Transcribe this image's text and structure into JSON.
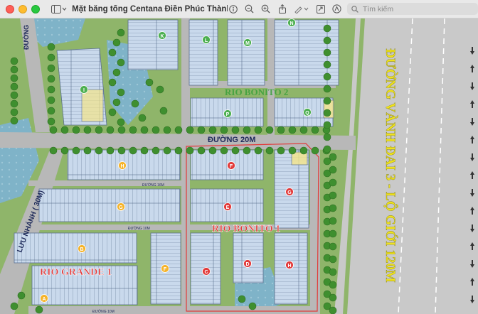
{
  "window": {
    "title": "Mặt bằng tổng Centana Điền Phúc Thành.jpg",
    "search_placeholder": "Tìm kiếm"
  },
  "map": {
    "roads": {
      "main_road": "ĐƯỜNG 20M",
      "left_top_road": "ĐƯỜNG",
      "left_diagonal_road": "LƯU NHÁNH ( 30M)",
      "inner_road_1": "ĐƯỜNG 16M",
      "inner_road_2": "ĐƯỜNG 10M",
      "inner_road_3": "ĐƯỜNG 10M",
      "ring_road": "ĐƯỜNG VÀNH ĐAI 3 - LỘ GIỚI 120M"
    },
    "zones": {
      "rio_bonito_top": "RIO BONITO 2",
      "rio_bonito": "RIO BONITO 1",
      "rio_grande": "RIO GRANDE 1"
    },
    "blocks": [
      "K",
      "L",
      "M",
      "N",
      "I",
      "P",
      "Q",
      "H",
      "F",
      "G",
      "E",
      "D",
      "C",
      "B",
      "A",
      "F",
      "G",
      "H"
    ]
  },
  "colors": {
    "lot": "#c9d9ec",
    "lot_line": "#5a6f8e",
    "highlight_lot": "#f4e58a",
    "grass": "#8fb56a",
    "road": "#b8b8b8",
    "ring_road": "#c9c9c9",
    "block_marker": "#f5b329",
    "zone_text": "#e23a3a",
    "zone_text_2": "#3aa03a",
    "ring_text": "#f0e21c"
  }
}
